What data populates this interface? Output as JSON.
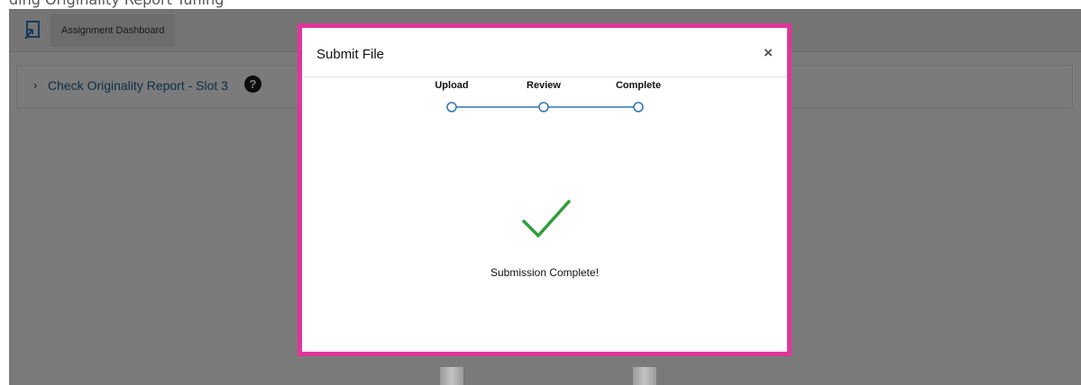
{
  "top_strip": {
    "text": "ding Originality Report Tuning"
  },
  "toolbar": {
    "tab_label": "Assignment Dashboard"
  },
  "panel": {
    "title": "Check Originality Report - Slot 3",
    "help_glyph": "?"
  },
  "modal": {
    "title": "Submit File",
    "close_glyph": "×",
    "steps": [
      {
        "label": "Upload"
      },
      {
        "label": "Review"
      },
      {
        "label": "Complete"
      }
    ],
    "message": "Submission Complete!"
  },
  "colors": {
    "highlight_border": "#e0359a",
    "step_line": "#2d73b8",
    "check": "#2e9d3b",
    "link": "#1a5c8e"
  },
  "icons": {
    "logo": "return-arrow-icon",
    "chevron": "chevron-right-icon",
    "help": "question-circle-icon",
    "close": "close-icon",
    "success": "checkmark-icon"
  }
}
